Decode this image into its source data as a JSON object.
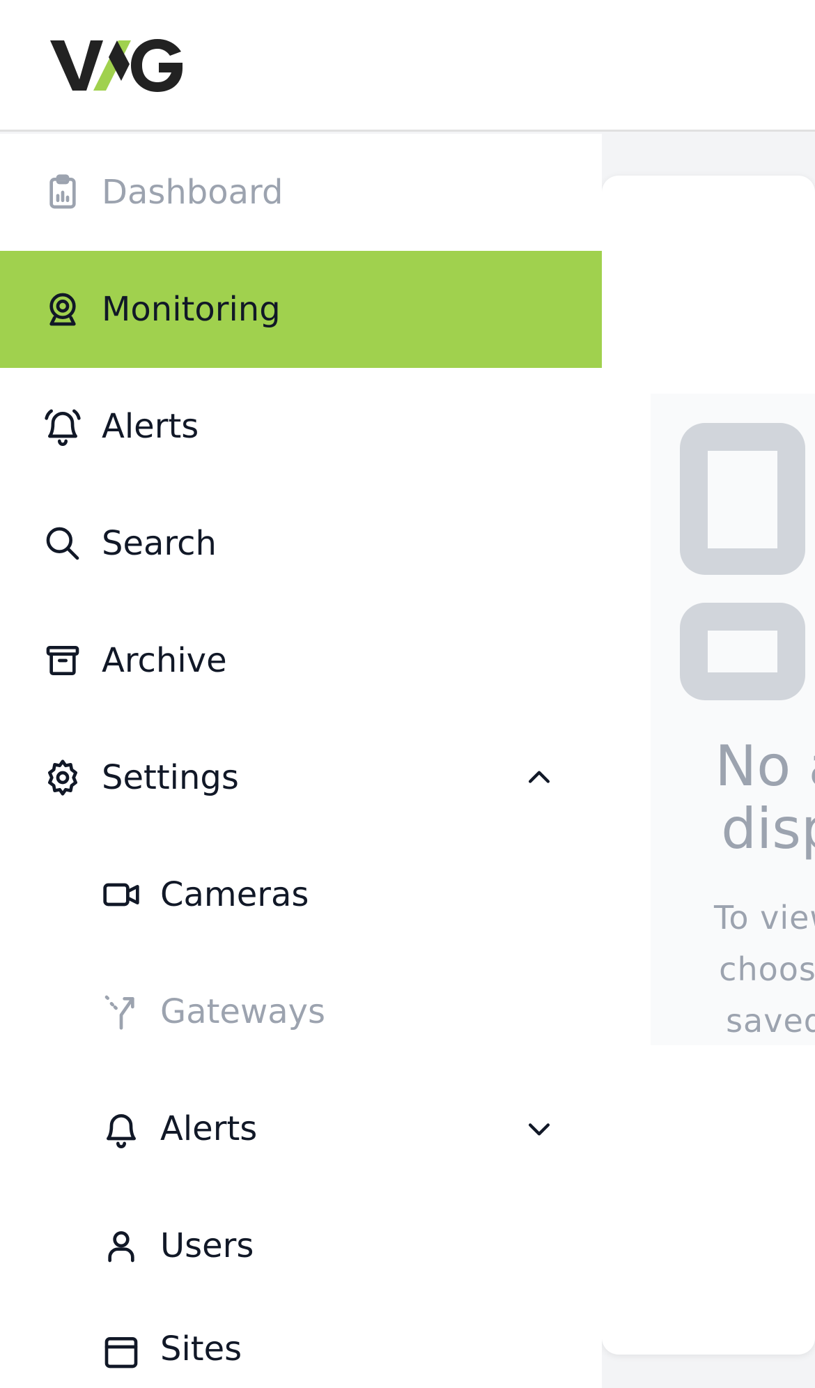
{
  "brand": {
    "logo_text": "VXG",
    "accent": "#a0d14e",
    "dark": "#222222"
  },
  "sidebar": {
    "items": [
      {
        "label": "Dashboard",
        "icon": "clipboard-chart-icon",
        "state": "muted"
      },
      {
        "label": "Monitoring",
        "icon": "webcam-icon",
        "state": "active"
      },
      {
        "label": "Alerts",
        "icon": "bell-ring-icon",
        "state": "normal"
      },
      {
        "label": "Search",
        "icon": "search-icon",
        "state": "normal"
      },
      {
        "label": "Archive",
        "icon": "archive-box-icon",
        "state": "normal"
      },
      {
        "label": "Settings",
        "icon": "gear-icon",
        "state": "expanded"
      }
    ],
    "settings_children": [
      {
        "label": "Cameras",
        "icon": "video-camera-icon",
        "state": "normal"
      },
      {
        "label": "Gateways",
        "icon": "gateway-icon",
        "state": "muted"
      },
      {
        "label": "Alerts",
        "icon": "bell-icon",
        "state": "collapsed"
      },
      {
        "label": "Users",
        "icon": "user-icon",
        "state": "normal"
      },
      {
        "label": "Sites",
        "icon": "browser-window-icon",
        "state": "normal"
      }
    ]
  },
  "main": {
    "empty_state": {
      "title": "No a\ndisp",
      "description": "To view c\nchoose t\nsaved c"
    }
  }
}
